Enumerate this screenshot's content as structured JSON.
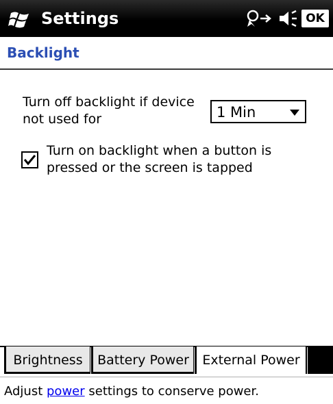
{
  "title_bar": {
    "app_title": "Settings",
    "ok_label": "OK",
    "icons": [
      "windows-start-icon",
      "connectivity-icon",
      "volume-icon"
    ]
  },
  "page": {
    "title": "Backlight",
    "off_label": "Turn off backlight if device not used for",
    "timeout_value": "1 Min",
    "tap_checkbox": {
      "label": "Turn on backlight when a button is pressed or the screen is tapped",
      "checked": true
    }
  },
  "tabs": [
    {
      "label": "Brightness",
      "active": false
    },
    {
      "label": "Battery Power",
      "active": false
    },
    {
      "label": "External Power",
      "active": true
    }
  ],
  "footer": {
    "prefix": "Adjust ",
    "link": "power",
    "suffix": " settings to conserve power."
  },
  "colors": {
    "title_bar_bg": "#000000",
    "page_title": "#2c4fb4",
    "link": "#0000ee"
  }
}
